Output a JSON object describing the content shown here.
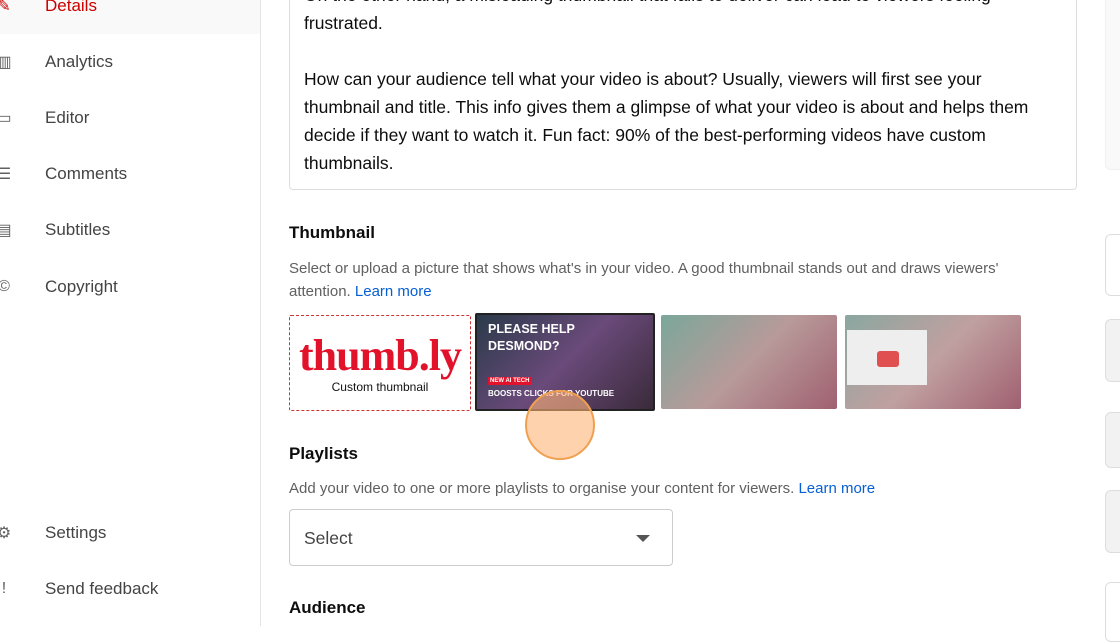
{
  "sidebar": {
    "items": [
      {
        "label": "Details",
        "icon": "pencil-icon"
      },
      {
        "label": "Analytics",
        "icon": "analytics-icon"
      },
      {
        "label": "Editor",
        "icon": "editor-icon"
      },
      {
        "label": "Comments",
        "icon": "comments-icon"
      },
      {
        "label": "Subtitles",
        "icon": "subtitles-icon"
      },
      {
        "label": "Copyright",
        "icon": "copyright-icon"
      },
      {
        "label": "Settings",
        "icon": "gear-icon"
      },
      {
        "label": "Send feedback",
        "icon": "feedback-icon"
      }
    ]
  },
  "description": {
    "p1": "On the other hand, a misleading thumbnail that fails to deliver can lead to viewers feeling frustrated.",
    "p2": "How can your audience tell what your video is about? Usually, viewers will first see your thumbnail and title. This info gives them a glimpse of what your video is about and helps them decide if they want to watch it. Fun fact: 90% of the best-performing videos have custom thumbnails."
  },
  "thumbnail": {
    "title": "Thumbnail",
    "text": "Select or upload a picture that shows what's in your video. A good thumbnail stands out and draws viewers' attention.",
    "link": "Learn more",
    "custom_logo": "thumb.ly",
    "custom_label": "Custom thumbnail",
    "selected": {
      "headline": "PLEASE HELP DESMOND?",
      "badge": "NEW AI TECH",
      "bottom": "BOOSTS CLICKS FOR YOUTUBE"
    }
  },
  "playlists": {
    "title": "Playlists",
    "text": "Add your video to one or more playlists to organise your content for viewers.",
    "link": "Learn more",
    "select": "Select"
  },
  "audience": {
    "title": "Audience"
  },
  "accent": "#cc0000"
}
